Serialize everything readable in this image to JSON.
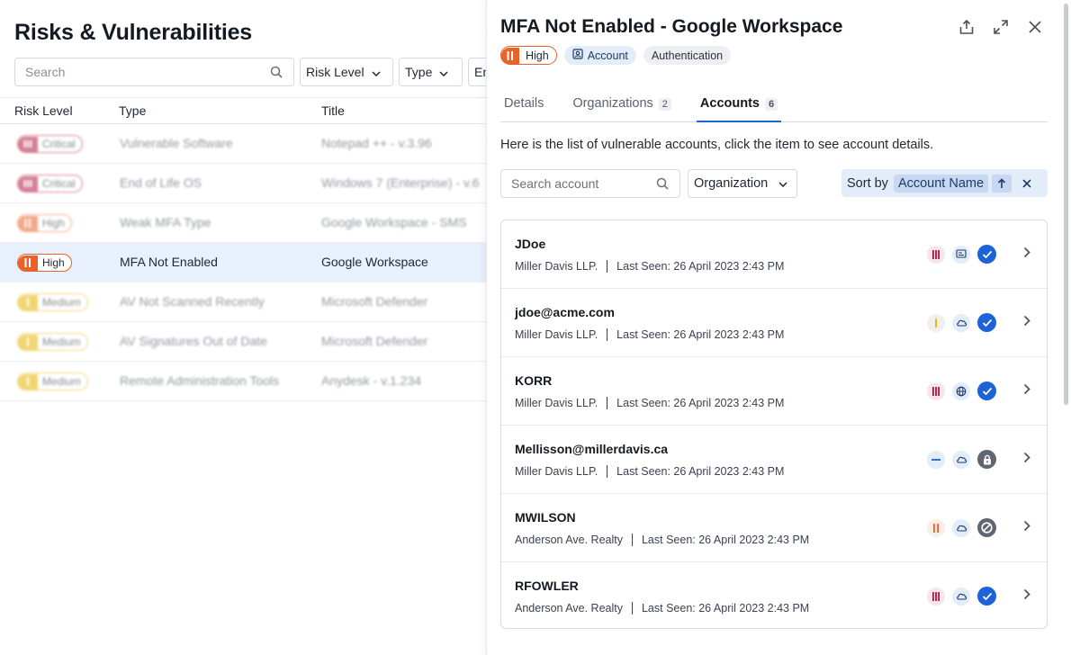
{
  "left": {
    "title": "Risks & Vulnerabilities",
    "search_placeholder": "Search",
    "filters": [
      "Risk Level",
      "Type",
      "En"
    ],
    "columns": [
      "Risk Level",
      "Type",
      "Title"
    ],
    "rows": [
      {
        "risk": "Critical",
        "type": "Vulnerable Software",
        "title": "Notepad ++ - v.3.96",
        "blurred": true
      },
      {
        "risk": "Critical",
        "type": "End of Life OS",
        "title": "Windows 7 (Enterprise) - v.6",
        "blurred": true
      },
      {
        "risk": "High",
        "type": "Weak MFA Type",
        "title": "Google Workspace - SMS",
        "blurred": true
      },
      {
        "risk": "High",
        "type": "MFA Not Enabled",
        "title": "Google Workspace",
        "blurred": false,
        "selected": true
      },
      {
        "risk": "Medium",
        "type": "AV Not Scanned Recently",
        "title": "Microsoft Defender",
        "blurred": true
      },
      {
        "risk": "Medium",
        "type": "AV Signatures Out of Date",
        "title": "Microsoft Defender",
        "blurred": true
      },
      {
        "risk": "Medium",
        "type": "Remote Administration Tools",
        "title": "Anydesk - v.1.234",
        "blurred": true
      }
    ]
  },
  "colors": {
    "critical": "#b3173f",
    "high": "#e8622a",
    "medium": "#e6b400",
    "accent": "#1d63d8",
    "success": "#1d63d8"
  },
  "detail": {
    "title": "MFA Not Enabled - Google Workspace",
    "tags": {
      "risk": "High",
      "category": "Account",
      "subtype": "Authentication"
    },
    "tabs": [
      {
        "label": "Details",
        "count": null,
        "active": false
      },
      {
        "label": "Organizations",
        "count": "2",
        "active": false
      },
      {
        "label": "Accounts",
        "count": "6",
        "active": true
      }
    ],
    "description": "Here is the list of vulnerable accounts, click the item to see account details.",
    "search_placeholder": "Search account",
    "org_filter": "Organization",
    "sort_label": "Sort by",
    "sort_value": "Account Name",
    "accounts": [
      {
        "name": "JDoe",
        "org": "Miller Davis LLP.",
        "last_seen": "Last Seen: 26 April 2023 2:43 PM",
        "severity": "critical",
        "source": "directory-icon",
        "status": "verified"
      },
      {
        "name": "jdoe@acme.com",
        "org": "Miller Davis LLP.",
        "last_seen": "Last Seen: 26 April 2023 2:43 PM",
        "severity": "medium",
        "source": "cloud-icon",
        "status": "verified"
      },
      {
        "name": "KORR",
        "org": "Miller Davis LLP.",
        "last_seen": "Last Seen: 26 April 2023 2:43 PM",
        "severity": "critical",
        "source": "globe-icon",
        "status": "verified"
      },
      {
        "name": "Mellisson@millerdavis.ca",
        "org": "Miller Davis LLP.",
        "last_seen": "Last Seen: 26 April 2023 2:43 PM",
        "severity": "low",
        "source": "cloud-icon",
        "status": "locked"
      },
      {
        "name": "MWILSON",
        "org": "Anderson Ave. Realty",
        "last_seen": "Last Seen: 26 April 2023 2:43 PM",
        "severity": "high",
        "source": "cloud-icon",
        "status": "disabled"
      },
      {
        "name": "RFOWLER",
        "org": "Anderson Ave. Realty",
        "last_seen": "Last Seen: 26 April 2023 2:43 PM",
        "severity": "critical",
        "source": "cloud-icon",
        "status": "verified"
      }
    ]
  }
}
